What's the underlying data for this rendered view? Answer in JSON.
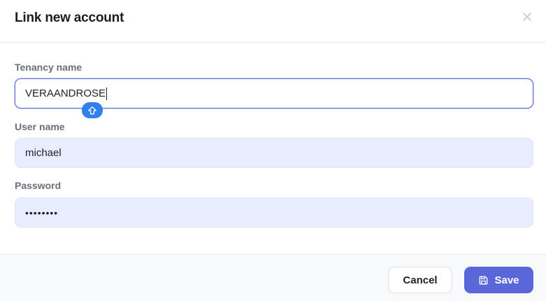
{
  "dialog": {
    "title": "Link new account"
  },
  "form": {
    "tenancy": {
      "label": "Tenancy name",
      "value": "VERAANDROSE"
    },
    "username": {
      "label": "User name",
      "value": "michael"
    },
    "password": {
      "label": "Password",
      "value": "••••••••"
    }
  },
  "footer": {
    "cancel_label": "Cancel",
    "save_label": "Save"
  },
  "icons": {
    "close": "close-icon",
    "caps_lock": "caps-lock-icon",
    "save": "save-icon"
  },
  "colors": {
    "accent": "#5a67d8",
    "input_bg": "#e8eeff",
    "caps_badge": "#2f80ed"
  }
}
